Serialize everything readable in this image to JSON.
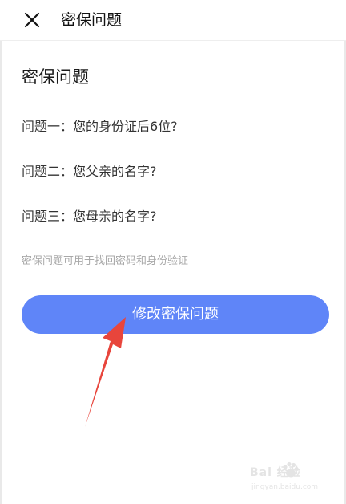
{
  "nav": {
    "title": "密保问题",
    "close_icon": "close-icon"
  },
  "content": {
    "heading": "密保问题",
    "questions": [
      "问题一：您的身份证后6位?",
      "问题二：您父亲的名字?",
      "问题三：您母亲的名字?"
    ],
    "hint": "密保问题可用于找回密码和身份验证",
    "modify_button_label": "修改密保问题"
  },
  "colors": {
    "button_bg": "#5f85f8",
    "annotation_arrow": "#e8453c",
    "hint_text": "#a8a8a8"
  },
  "watermark": {
    "brand": "Bai 经验",
    "url": "jingyan.baidu.com"
  }
}
